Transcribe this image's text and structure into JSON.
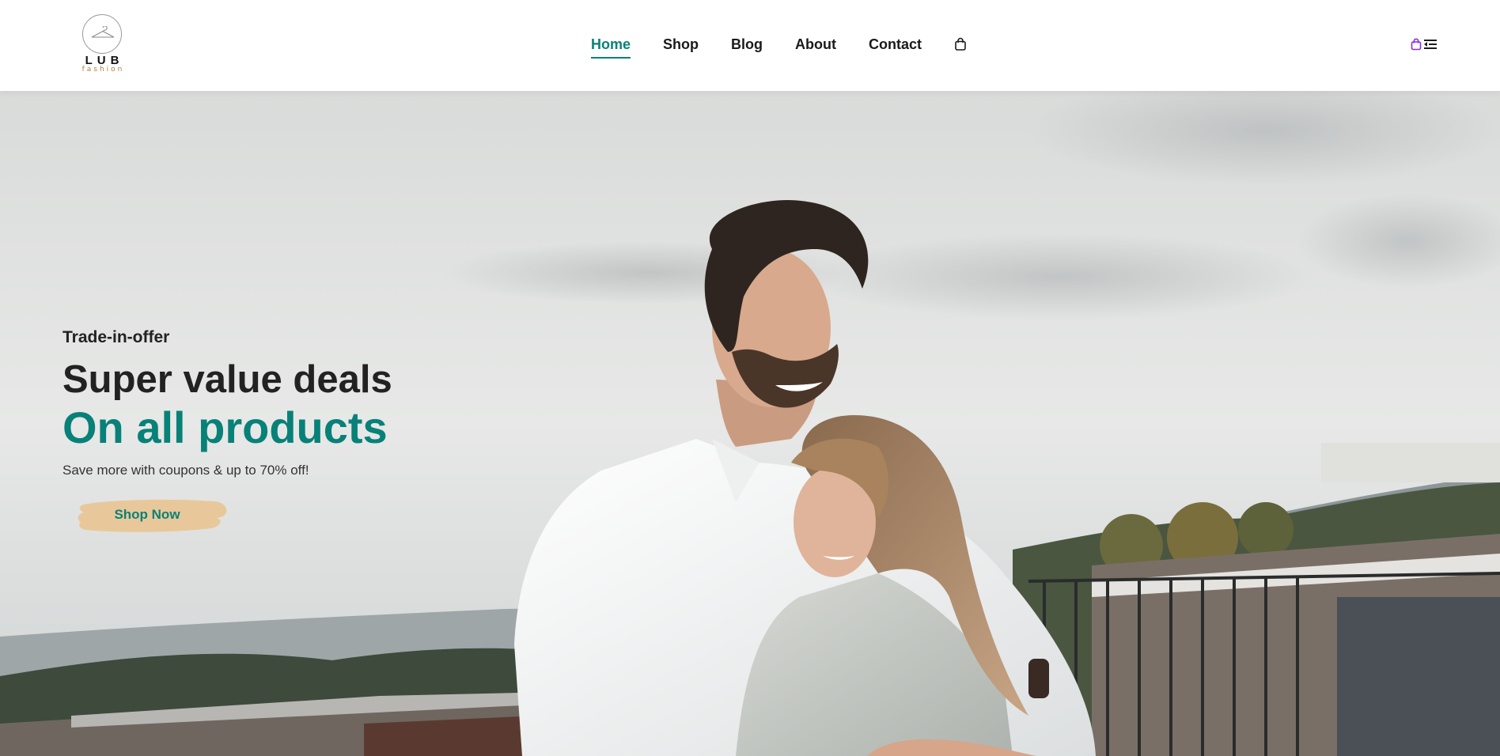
{
  "brand": {
    "name": "LUB",
    "tagline": "fashion"
  },
  "nav": {
    "items": [
      {
        "label": "Home",
        "active": true
      },
      {
        "label": "Shop",
        "active": false
      },
      {
        "label": "Blog",
        "active": false
      },
      {
        "label": "About",
        "active": false
      },
      {
        "label": "Contact",
        "active": false
      }
    ],
    "bag_icon": "shopping-bag-icon"
  },
  "header_right": {
    "icons": [
      "shopping-bag-icon",
      "menu-icon"
    ]
  },
  "hero": {
    "eyebrow": "Trade-in-offer",
    "title_line1": "Super value deals",
    "title_line2": "On all products",
    "subtitle": "Save more with coupons & up to 70% off!",
    "cta_label": "Shop Now"
  },
  "colors": {
    "accent": "#088178",
    "cta_background": "#e8c89a",
    "text_dark": "#222222",
    "icon_purple": "#8a2be2"
  }
}
